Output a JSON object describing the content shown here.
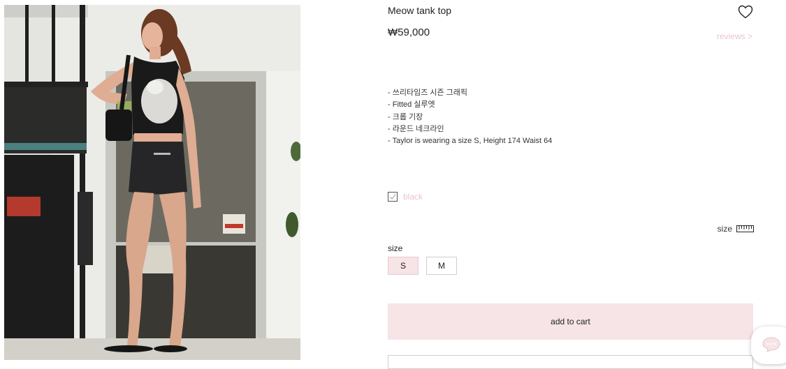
{
  "product": {
    "title": "Meow tank top",
    "price": "₩59,000",
    "reviews_link": "reviews >",
    "description": [
      "- 쓰리타임즈 시즌 그래픽",
      "- Fitted 실루엣",
      "- 크롭 기장",
      "- 라운드 네크라인",
      "- Taylor is wearing a size S, Height 174 Waist 64"
    ],
    "color_option": "black",
    "size_guide_label": "size",
    "size_label": "size",
    "sizes": [
      "S",
      "M"
    ],
    "selected_size": "S",
    "add_to_cart": "add to cart"
  },
  "icons": {
    "wishlist": "heart-icon",
    "size_guide": "ruler-icon",
    "color_check": "check-icon",
    "chat": "chat-bubble-icon"
  },
  "colors": {
    "accent_pink_bg": "#f6e4e6",
    "accent_pink_text": "#e9c4c9",
    "text": "#222222"
  }
}
